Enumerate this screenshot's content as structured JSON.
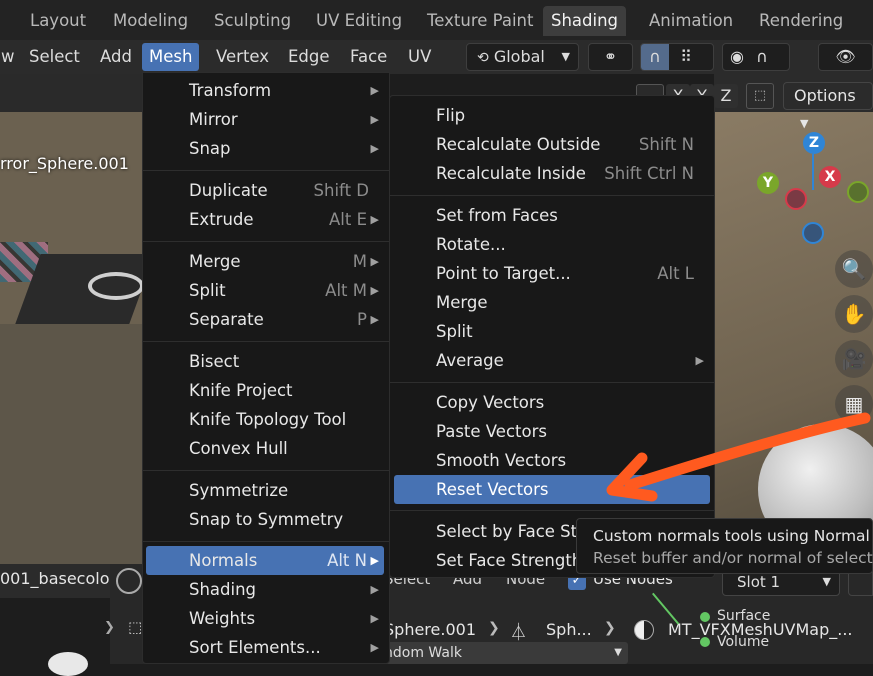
{
  "workspace_tabs": [
    "Layout",
    "Modeling",
    "Sculpting",
    "UV Editing",
    "Texture Paint",
    "Shading",
    "Animation",
    "Rendering"
  ],
  "header_menu": {
    "partial_view": "w",
    "select": "Select",
    "add": "Add",
    "mesh": "Mesh",
    "vertex": "Vertex",
    "edge": "Edge",
    "face": "Face",
    "uv": "UV",
    "orientation": "Global"
  },
  "viewport": {
    "object_label": "rror_Sphere.001",
    "options_label": "Options",
    "axis_x": "X",
    "axis_y": "Y",
    "axis_z": "Z"
  },
  "mesh_menu": {
    "items": [
      {
        "label": "Transform",
        "shortcut": "",
        "submenu": true
      },
      {
        "label": "Mirror",
        "shortcut": "",
        "submenu": true
      },
      {
        "label": "Snap",
        "shortcut": "",
        "submenu": true
      },
      {
        "label": "Duplicate",
        "shortcut": "Shift D",
        "submenu": false
      },
      {
        "label": "Extrude",
        "shortcut": "Alt E",
        "submenu": true
      },
      {
        "label": "Merge",
        "shortcut": "M",
        "submenu": true
      },
      {
        "label": "Split",
        "shortcut": "Alt M",
        "submenu": true
      },
      {
        "label": "Separate",
        "shortcut": "P",
        "submenu": true
      },
      {
        "label": "Bisect",
        "shortcut": "",
        "submenu": false
      },
      {
        "label": "Knife Project",
        "shortcut": "",
        "submenu": false
      },
      {
        "label": "Knife Topology Tool",
        "shortcut": "",
        "submenu": false
      },
      {
        "label": "Convex Hull",
        "shortcut": "",
        "submenu": false
      },
      {
        "label": "Symmetrize",
        "shortcut": "",
        "submenu": false
      },
      {
        "label": "Snap to Symmetry",
        "shortcut": "",
        "submenu": false
      },
      {
        "label": "Normals",
        "shortcut": "Alt N",
        "submenu": true
      },
      {
        "label": "Shading",
        "shortcut": "",
        "submenu": true
      },
      {
        "label": "Weights",
        "shortcut": "",
        "submenu": true
      },
      {
        "label": "Sort Elements...",
        "shortcut": "",
        "submenu": true
      }
    ]
  },
  "normals_menu": {
    "items": [
      {
        "label": "Flip",
        "shortcut": "",
        "submenu": false
      },
      {
        "label": "Recalculate Outside",
        "shortcut": "Shift N",
        "submenu": false
      },
      {
        "label": "Recalculate Inside",
        "shortcut": "Shift Ctrl N",
        "submenu": false
      },
      {
        "label": "Set from Faces",
        "shortcut": "",
        "submenu": false
      },
      {
        "label": "Rotate...",
        "shortcut": "",
        "submenu": false
      },
      {
        "label": "Point to Target...",
        "shortcut": "Alt L",
        "submenu": false
      },
      {
        "label": "Merge",
        "shortcut": "",
        "submenu": false
      },
      {
        "label": "Split",
        "shortcut": "",
        "submenu": false
      },
      {
        "label": "Average",
        "shortcut": "",
        "submenu": true
      },
      {
        "label": "Copy Vectors",
        "shortcut": "",
        "submenu": false
      },
      {
        "label": "Paste Vectors",
        "shortcut": "",
        "submenu": false
      },
      {
        "label": "Smooth Vectors",
        "shortcut": "",
        "submenu": false
      },
      {
        "label": "Reset Vectors",
        "shortcut": "",
        "submenu": false
      },
      {
        "label": "Select by Face Str",
        "shortcut": "",
        "submenu": false
      },
      {
        "label": "Set Face Strength",
        "shortcut": "",
        "submenu": false
      }
    ]
  },
  "tooltip": {
    "line1": "Custom normals tools using Normal",
    "line2": "Reset buffer and/or normal of select"
  },
  "bottom": {
    "image_name": "001_basecolo",
    "select": "Select",
    "add": "Add",
    "node": "Node",
    "use_nodes": "Use Nodes",
    "slot": "Slot 1",
    "breadcrumb_obj": "Sphere.001",
    "breadcrumb_mesh": "Sph...",
    "material": "MT_VFXMeshUVMap_...",
    "random_walk": "ndom Walk",
    "surface": "Surface",
    "volume": "Volume"
  },
  "colors": {
    "accent": "#4772b3",
    "annotation_arrow": "#ff5a1f",
    "axis_x": "#d63a4a",
    "axis_y": "#7aa62a",
    "axis_z": "#2f85d6"
  }
}
